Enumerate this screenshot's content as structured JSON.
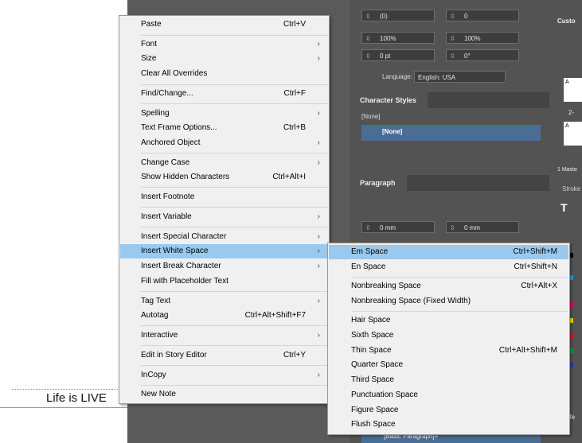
{
  "document": {
    "text": "Life is LIVE"
  },
  "context_menu": {
    "items": [
      {
        "label": "Paste",
        "shortcut": "Ctrl+V",
        "submenu": false
      },
      {
        "label": "Font",
        "shortcut": "",
        "submenu": true
      },
      {
        "label": "Size",
        "shortcut": "",
        "submenu": true
      },
      {
        "label": "Clear All Overrides",
        "shortcut": "",
        "submenu": false
      },
      {
        "label": "Find/Change...",
        "shortcut": "Ctrl+F",
        "submenu": false
      },
      {
        "label": "Spelling",
        "shortcut": "",
        "submenu": true
      },
      {
        "label": "Text Frame Options...",
        "shortcut": "Ctrl+B",
        "submenu": false
      },
      {
        "label": "Anchored Object",
        "shortcut": "",
        "submenu": true
      },
      {
        "label": "Change Case",
        "shortcut": "",
        "submenu": true
      },
      {
        "label": "Show Hidden Characters",
        "shortcut": "Ctrl+Alt+I",
        "submenu": false
      },
      {
        "label": "Insert Footnote",
        "shortcut": "",
        "submenu": false
      },
      {
        "label": "Insert Variable",
        "shortcut": "",
        "submenu": true
      },
      {
        "label": "Insert Special Character",
        "shortcut": "",
        "submenu": true
      },
      {
        "label": "Insert White Space",
        "shortcut": "",
        "submenu": true
      },
      {
        "label": "Insert Break Character",
        "shortcut": "",
        "submenu": true
      },
      {
        "label": "Fill with Placeholder Text",
        "shortcut": "",
        "submenu": false
      },
      {
        "label": "Tag Text",
        "shortcut": "",
        "submenu": true
      },
      {
        "label": "Autotag",
        "shortcut": "Ctrl+Alt+Shift+F7",
        "submenu": false
      },
      {
        "label": "Interactive",
        "shortcut": "",
        "submenu": true
      },
      {
        "label": "Edit in Story Editor",
        "shortcut": "Ctrl+Y",
        "submenu": false
      },
      {
        "label": "InCopy",
        "shortcut": "",
        "submenu": true
      },
      {
        "label": "New Note",
        "shortcut": "",
        "submenu": false
      }
    ]
  },
  "submenu": {
    "items": [
      {
        "label": "Em Space",
        "shortcut": "Ctrl+Shift+M"
      },
      {
        "label": "En Space",
        "shortcut": "Ctrl+Shift+N"
      },
      {
        "label": "Nonbreaking Space",
        "shortcut": "Ctrl+Alt+X"
      },
      {
        "label": "Nonbreaking Space (Fixed Width)",
        "shortcut": ""
      },
      {
        "label": "Hair Space",
        "shortcut": ""
      },
      {
        "label": "Sixth Space",
        "shortcut": ""
      },
      {
        "label": "Thin Space",
        "shortcut": "Ctrl+Alt+Shift+M"
      },
      {
        "label": "Quarter Space",
        "shortcut": ""
      },
      {
        "label": "Third Space",
        "shortcut": ""
      },
      {
        "label": "Punctuation Space",
        "shortcut": ""
      },
      {
        "label": "Figure Space",
        "shortcut": ""
      },
      {
        "label": "Flush Space",
        "shortcut": ""
      }
    ]
  },
  "char_panel": {
    "kerning": "(0)",
    "tracking": "0",
    "vscale": "100%",
    "hscale": "100%",
    "baseline": "0 pt",
    "skew": "0°",
    "language_label": "Language:",
    "language": "English: USA"
  },
  "char_styles": {
    "title": "Character Styles",
    "current": "[None]",
    "selected": "[None]"
  },
  "paragraph": {
    "title": "Paragraph",
    "left_indent": "0 mm",
    "right_indent": "0 mm",
    "style": "[Basic Paragraph]+"
  },
  "right_col": {
    "custom": "Custo",
    "master": "1 Maste",
    "stroke": "Stroke",
    "effects": "Effe",
    "page_a": "A",
    "page_num": "2-"
  }
}
